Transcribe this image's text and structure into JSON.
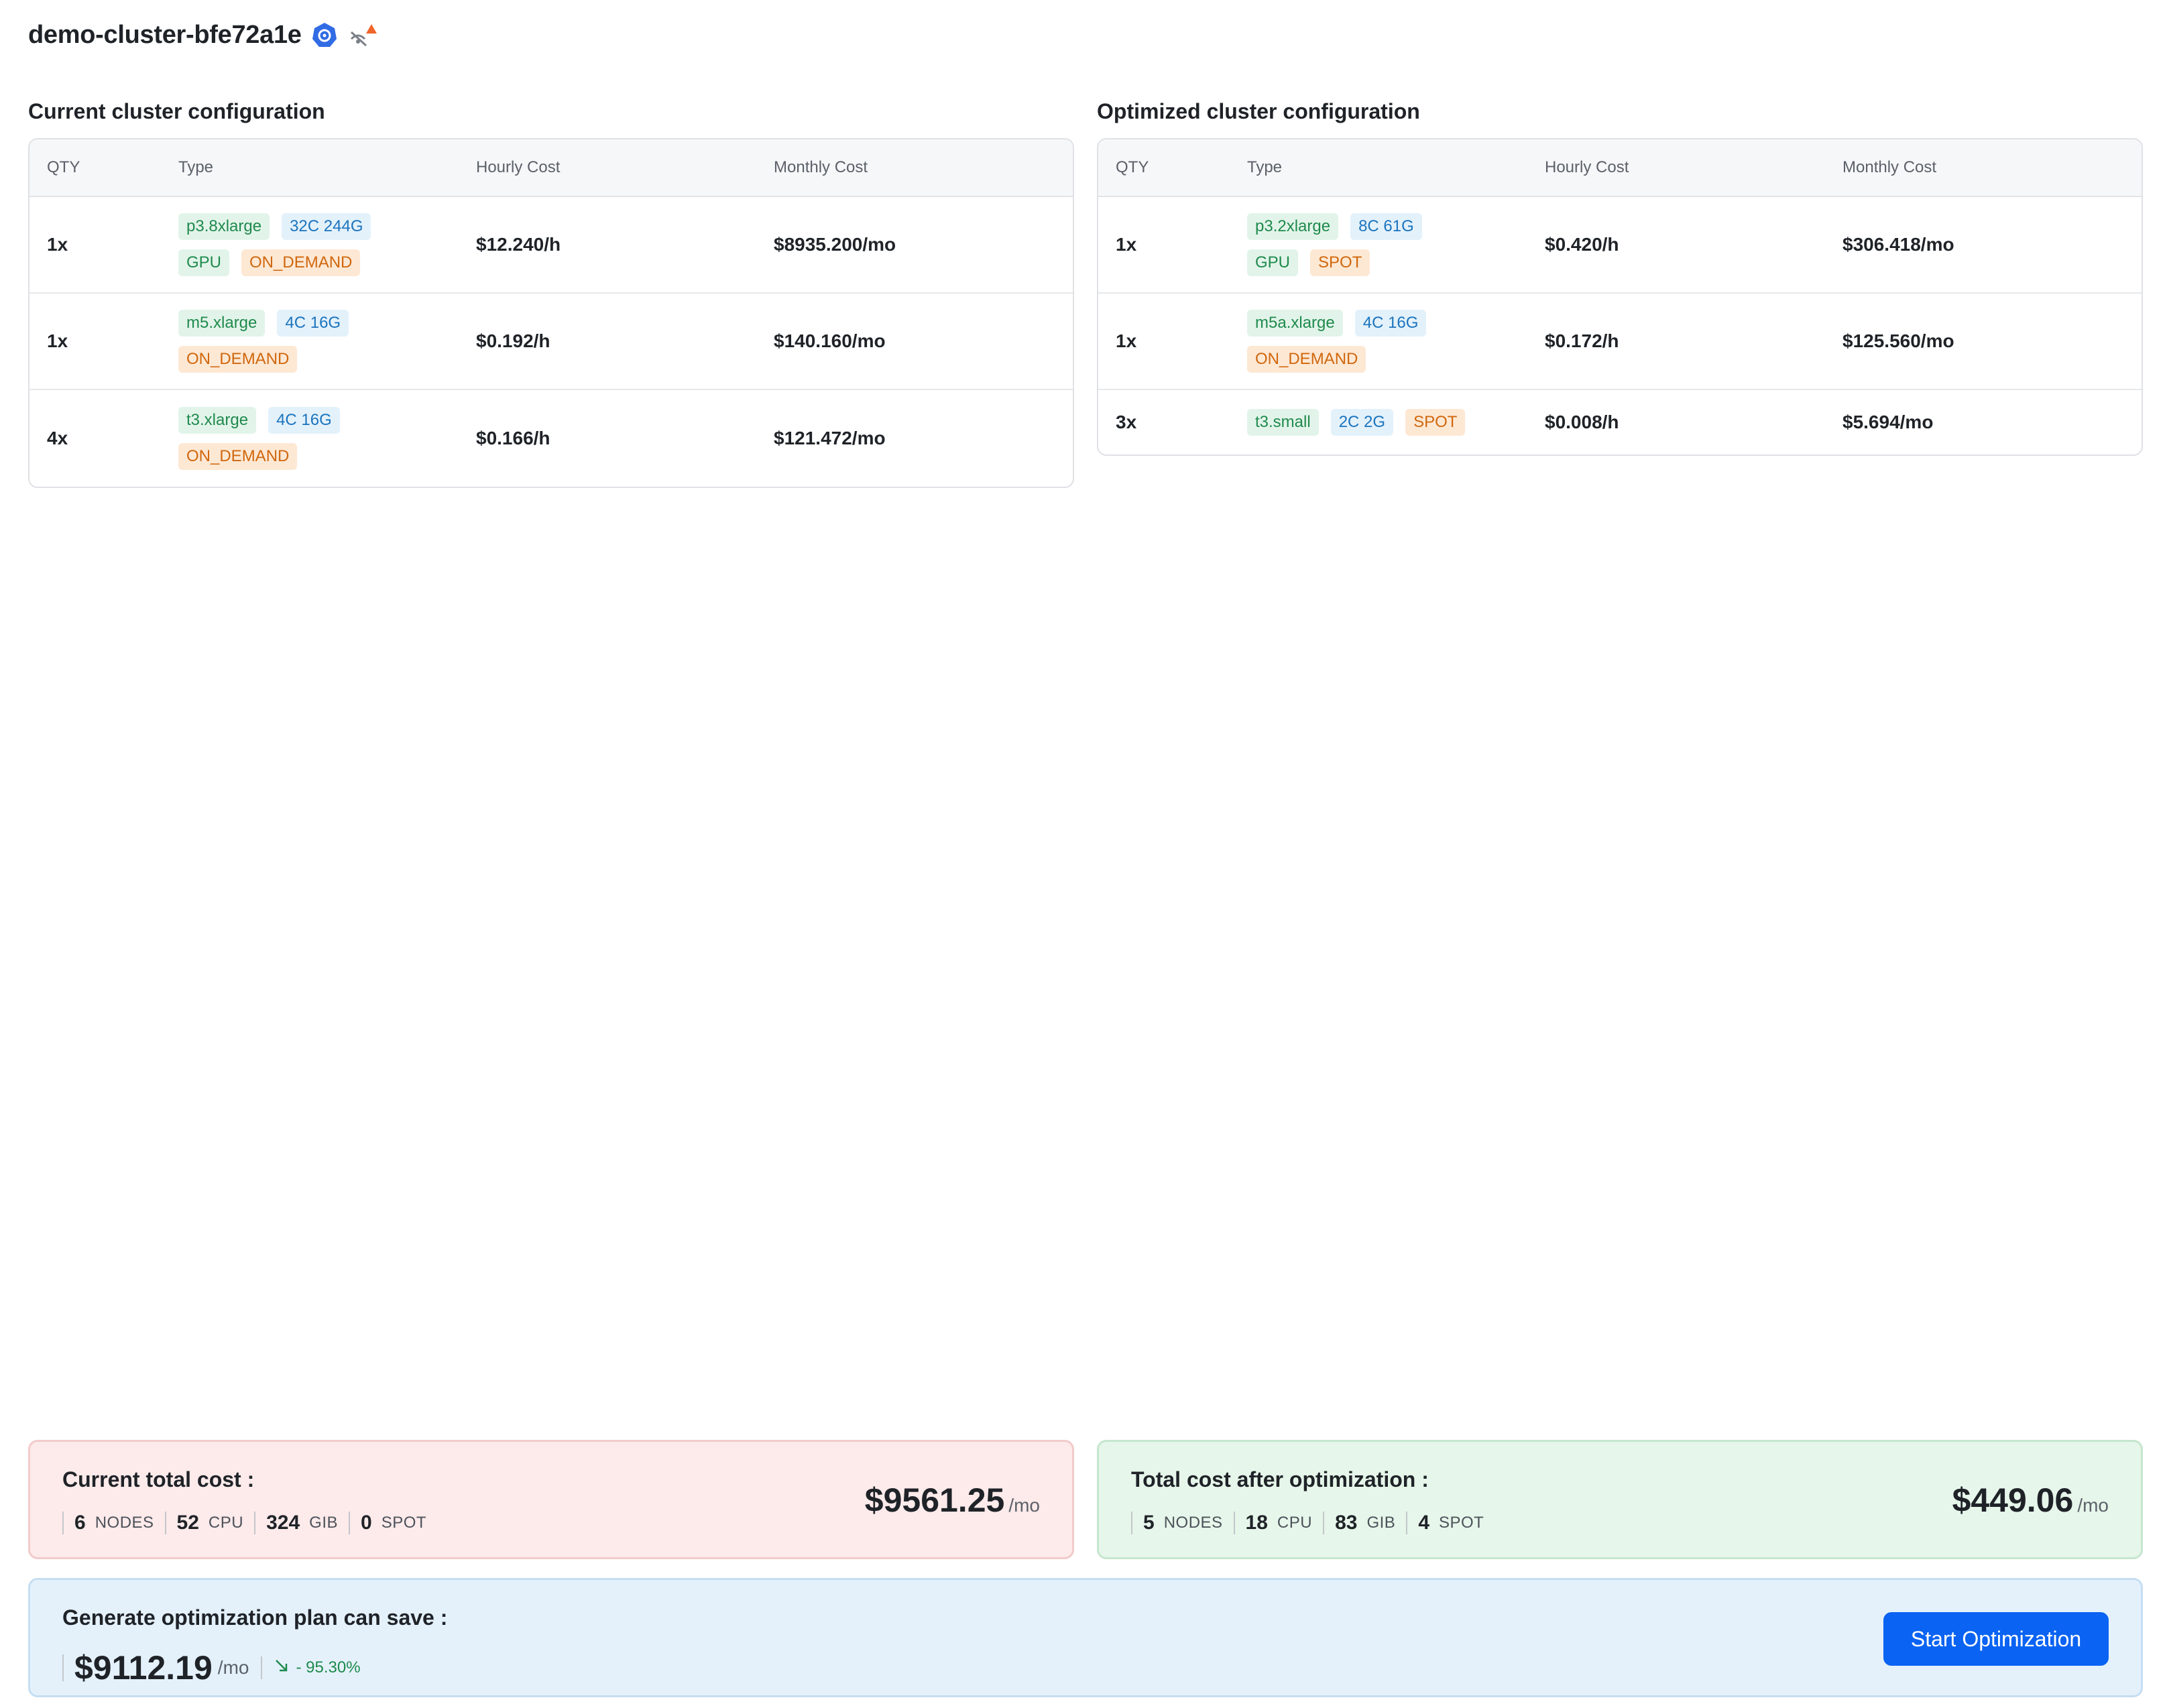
{
  "cluster": {
    "name": "demo-cluster-bfe72a1e",
    "icons": [
      "kubernetes-icon",
      "no-connection-warning-icon"
    ]
  },
  "current": {
    "title": "Current cluster configuration",
    "headers": {
      "qty": "QTY",
      "type": "Type",
      "hourly": "Hourly Cost",
      "monthly": "Monthly Cost"
    },
    "rows": [
      {
        "qty": "1x",
        "tags": [
          {
            "text": "p3.8xlarge",
            "color": "green"
          },
          {
            "text": "32C 244G",
            "color": "blue"
          },
          {
            "text": "GPU",
            "color": "green"
          },
          {
            "text": "ON_DEMAND",
            "color": "orange"
          }
        ],
        "hourly": "$12.240/h",
        "monthly": "$8935.200/mo"
      },
      {
        "qty": "1x",
        "tags": [
          {
            "text": "m5.xlarge",
            "color": "green"
          },
          {
            "text": "4C 16G",
            "color": "blue"
          },
          {
            "text": "ON_DEMAND",
            "color": "orange"
          }
        ],
        "hourly": "$0.192/h",
        "monthly": "$140.160/mo"
      },
      {
        "qty": "4x",
        "tags": [
          {
            "text": "t3.xlarge",
            "color": "green"
          },
          {
            "text": "4C 16G",
            "color": "blue"
          },
          {
            "text": "ON_DEMAND",
            "color": "orange"
          }
        ],
        "hourly": "$0.166/h",
        "monthly": "$121.472/mo"
      }
    ]
  },
  "optimized": {
    "title": "Optimized cluster configuration",
    "headers": {
      "qty": "QTY",
      "type": "Type",
      "hourly": "Hourly Cost",
      "monthly": "Monthly Cost"
    },
    "rows": [
      {
        "qty": "1x",
        "tags": [
          {
            "text": "p3.2xlarge",
            "color": "green"
          },
          {
            "text": "8C 61G",
            "color": "blue"
          },
          {
            "text": "GPU",
            "color": "green"
          },
          {
            "text": "SPOT",
            "color": "orange"
          }
        ],
        "hourly": "$0.420/h",
        "monthly": "$306.418/mo"
      },
      {
        "qty": "1x",
        "tags": [
          {
            "text": "m5a.xlarge",
            "color": "green"
          },
          {
            "text": "4C 16G",
            "color": "blue"
          },
          {
            "text": "ON_DEMAND",
            "color": "orange"
          }
        ],
        "hourly": "$0.172/h",
        "monthly": "$125.560/mo"
      },
      {
        "qty": "3x",
        "tags": [
          {
            "text": "t3.small",
            "color": "green"
          },
          {
            "text": "2C 2G",
            "color": "blue"
          },
          {
            "text": "SPOT",
            "color": "orange"
          }
        ],
        "hourly": "$0.008/h",
        "monthly": "$5.694/mo"
      }
    ]
  },
  "current_total": {
    "title": "Current total cost :",
    "stats": [
      {
        "value": "6",
        "label": "NODES"
      },
      {
        "value": "52",
        "label": "CPU"
      },
      {
        "value": "324",
        "label": "GIB"
      },
      {
        "value": "0",
        "label": "SPOT"
      }
    ],
    "amount": "$9561.25",
    "unit": "/mo"
  },
  "optimized_total": {
    "title": "Total cost after optimization :",
    "stats": [
      {
        "value": "5",
        "label": "NODES"
      },
      {
        "value": "18",
        "label": "CPU"
      },
      {
        "value": "83",
        "label": "GIB"
      },
      {
        "value": "4",
        "label": "SPOT"
      }
    ],
    "amount": "$449.06",
    "unit": "/mo"
  },
  "savings": {
    "title": "Generate optimization plan can save :",
    "amount": "$9112.19",
    "unit": "/mo",
    "percent": "- 95.30%",
    "button_label": "Start Optimization"
  },
  "colors": {
    "accent": "#0a63f2",
    "tag_green": "#1f8a4c",
    "tag_blue": "#1b74bd",
    "tag_orange": "#d0670d"
  }
}
